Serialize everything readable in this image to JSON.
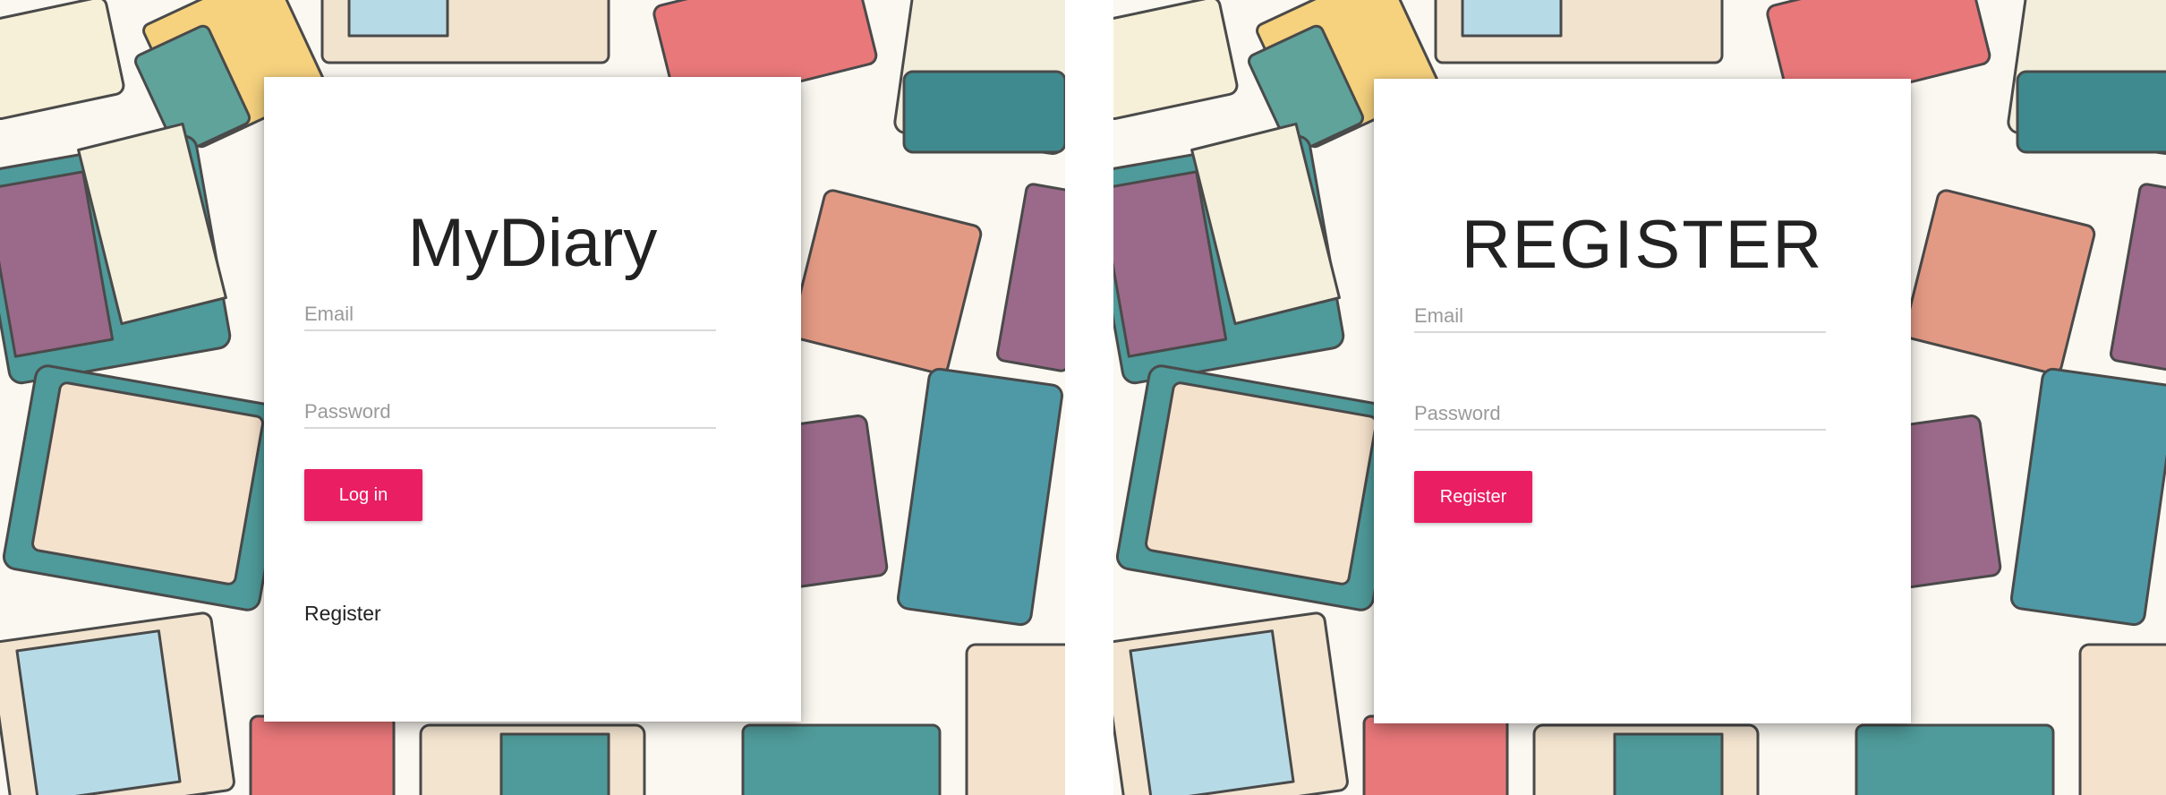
{
  "login": {
    "title": "MyDiary",
    "email_placeholder": "Email",
    "password_placeholder": "Password",
    "login_button": "Log in",
    "register_link": "Register"
  },
  "register": {
    "title": "REGISTER",
    "email_placeholder": "Email",
    "password_placeholder": "Password",
    "register_button": "Register"
  },
  "theme": {
    "accent": "#e91e63",
    "card_background": "#ffffff",
    "input_underline": "#d8d8d8",
    "placeholder_color": "#9a9a9a"
  }
}
